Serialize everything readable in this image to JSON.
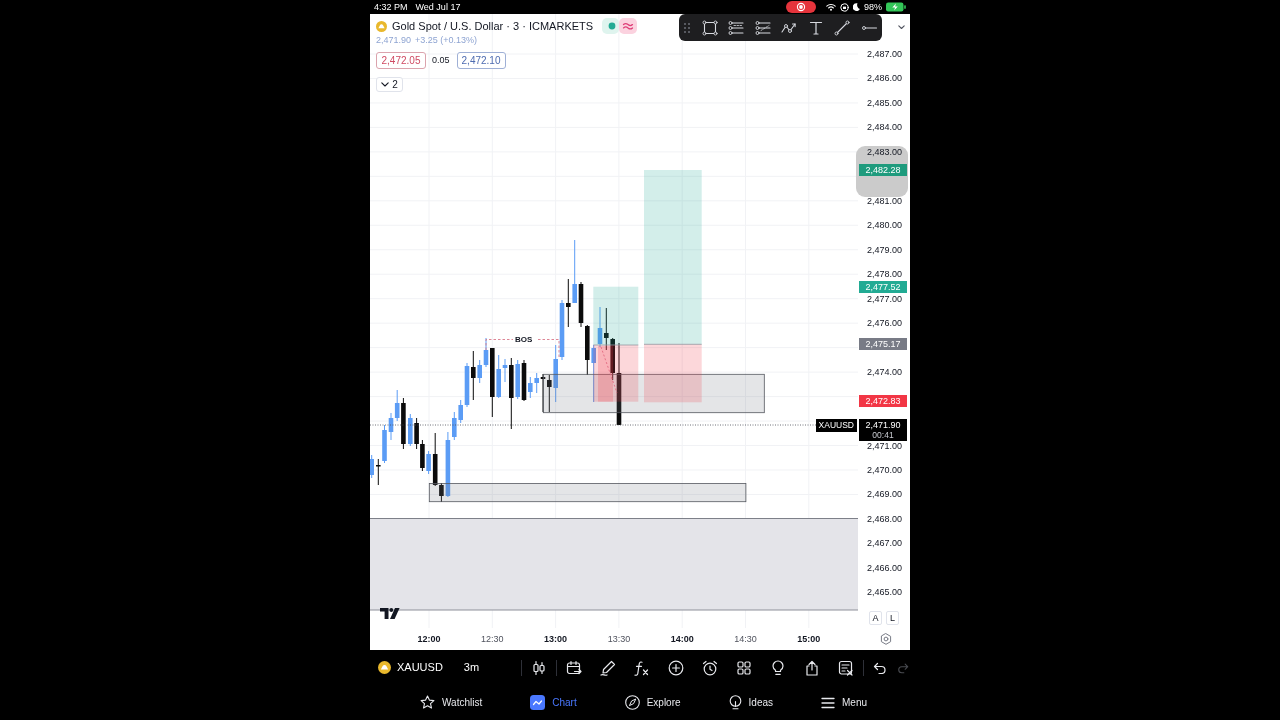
{
  "status_bar": {
    "time": "4:32 PM",
    "date": "Wed Jul 17",
    "battery": "98%"
  },
  "symbol_header": {
    "title": "Gold Spot / U.S. Dollar · 3 · ICMARKETS",
    "last_price": "2,471.90",
    "change": "+3.25 (+0.13%)",
    "sell_price": "2,472.05",
    "spread": "0.05",
    "buy_price": "2,472.10",
    "indicator_count": "2"
  },
  "chart": {
    "price_labels": [
      "2,487.00",
      "2,486.00",
      "2,485.00",
      "2,484.00",
      "2,483.00",
      "2,481.00",
      "2,480.00",
      "2,479.00",
      "2,478.00",
      "2,477.00",
      "2,476.00",
      "2,474.00",
      "2,471.00",
      "2,470.00",
      "2,469.00",
      "2,468.00",
      "2,467.00",
      "2,466.00",
      "2,465.00"
    ],
    "price_badges": [
      {
        "text": "2,482.28",
        "color": "#1e9b7d"
      },
      {
        "text": "2,477.52",
        "color": "#22ab94"
      },
      {
        "text": "2,475.17",
        "color": "#787b86"
      },
      {
        "text": "2,472.83",
        "color": "#f23645"
      }
    ],
    "current_price": {
      "symbol": "XAUUSD",
      "price": "2,471.90",
      "countdown": "00:41"
    },
    "bos_label": "BOS",
    "scale_buttons": [
      "A",
      "L"
    ],
    "time_labels": [
      {
        "text": "12:00",
        "major": true
      },
      {
        "text": "12:30",
        "major": false
      },
      {
        "text": "13:00",
        "major": true
      },
      {
        "text": "13:30",
        "major": false
      },
      {
        "text": "14:00",
        "major": true
      },
      {
        "text": "14:30",
        "major": false
      },
      {
        "text": "15:00",
        "major": true
      }
    ]
  },
  "bottom_toolbar": {
    "symbol": "XAUUSD",
    "interval": "3m"
  },
  "tabs": [
    {
      "label": "Watchlist",
      "selected": false
    },
    {
      "label": "Chart",
      "selected": true
    },
    {
      "label": "Explore",
      "selected": false
    },
    {
      "label": "Ideas",
      "selected": false
    },
    {
      "label": "Menu",
      "selected": false
    }
  ]
}
